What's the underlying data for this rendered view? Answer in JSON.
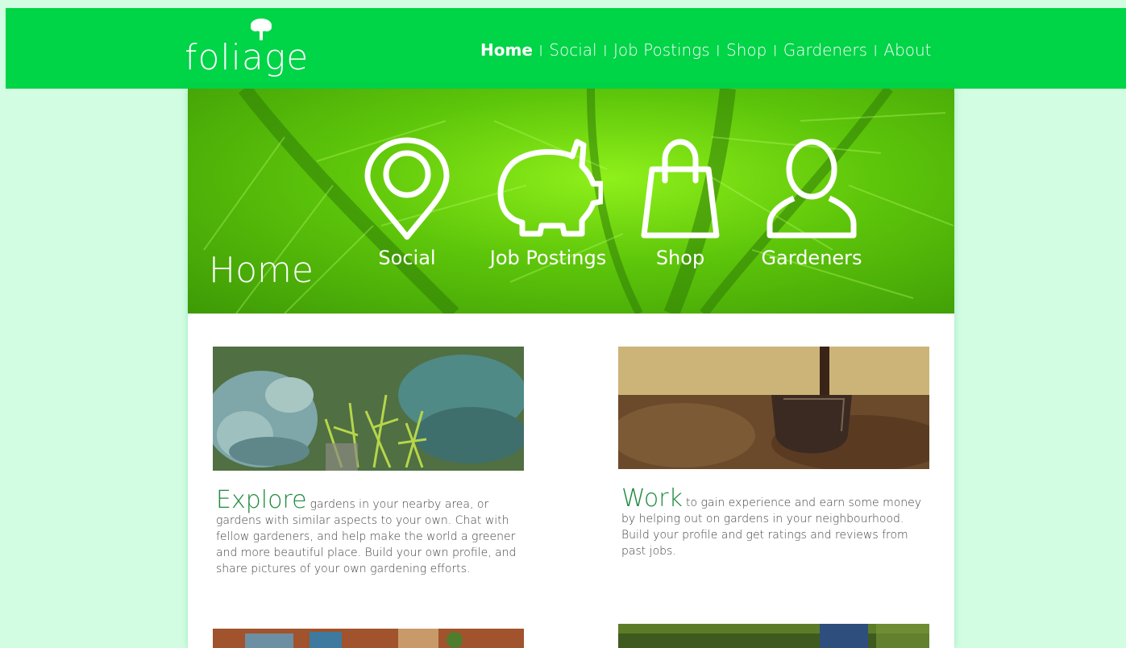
{
  "logo": {
    "text": "foliage"
  },
  "nav": {
    "items": [
      {
        "label": "Home",
        "active": true
      },
      {
        "label": "Social",
        "active": false
      },
      {
        "label": "Job Postings",
        "active": false
      },
      {
        "label": "Shop",
        "active": false
      },
      {
        "label": "Gardeners",
        "active": false
      },
      {
        "label": "About",
        "active": false
      }
    ],
    "separator": "|"
  },
  "hero": {
    "title": "Home",
    "items": [
      {
        "label": "Social",
        "icon": "map-pin-icon"
      },
      {
        "label": "Job Postings",
        "icon": "piggy-bank-icon"
      },
      {
        "label": "Shop",
        "icon": "shopping-bag-icon"
      },
      {
        "label": "Gardeners",
        "icon": "person-icon"
      }
    ]
  },
  "cards": [
    {
      "lead": "Explore",
      "text": "gardens in your nearby area, or gardens with similar aspects to your own. Chat with fellow gardeners, and help make the world a greener and more beautiful place. Build your own profile, and share pictures of your own gardening efforts."
    },
    {
      "lead": "Work",
      "text": "to gain experience and earn some money by helping out on gardens in your neighbourhood. Build your profile and get ratings and reviews from past jobs."
    }
  ],
  "colors": {
    "page_bg": "#d2fde2",
    "header_bg": "#00d447",
    "accent_text": "#1f8a3e"
  }
}
